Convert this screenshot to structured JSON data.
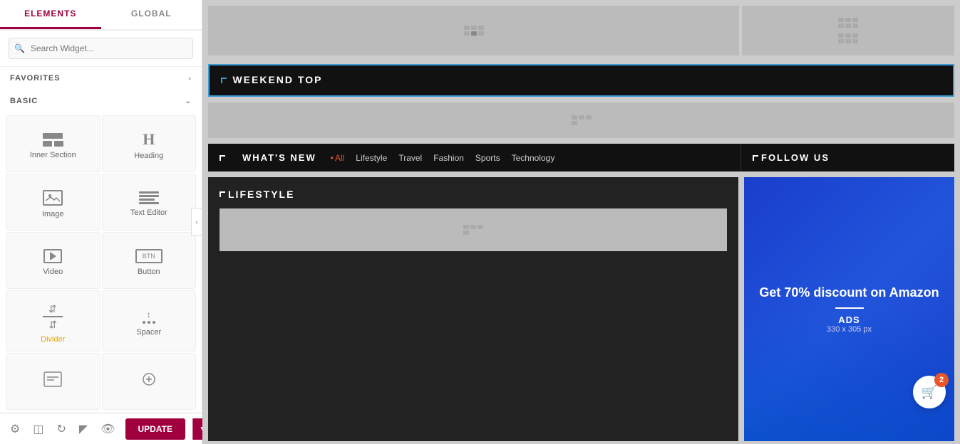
{
  "leftPanel": {
    "tabs": [
      {
        "id": "elements",
        "label": "ELEMENTS",
        "active": true
      },
      {
        "id": "global",
        "label": "GLOBAL",
        "active": false
      }
    ],
    "searchPlaceholder": "Search Widget...",
    "sections": {
      "favorites": {
        "label": "FAVORITES"
      },
      "basic": {
        "label": "BASIC",
        "widgets": [
          {
            "id": "inner-section",
            "label": "Inner Section"
          },
          {
            "id": "heading",
            "label": "Heading"
          },
          {
            "id": "image",
            "label": "Image"
          },
          {
            "id": "text-editor",
            "label": "Text Editor"
          },
          {
            "id": "video",
            "label": "Video"
          },
          {
            "id": "button",
            "label": "Button"
          },
          {
            "id": "divider",
            "label": "Divider"
          },
          {
            "id": "spacer",
            "label": "Spacer"
          }
        ]
      }
    },
    "toolbar": {
      "updateLabel": "UPDATE"
    }
  },
  "canvas": {
    "weekendSection": {
      "label": "WEEKEND TOP"
    },
    "whatsNew": {
      "title": "WHAT'S NEW",
      "navItems": [
        {
          "label": "All",
          "active": true
        },
        {
          "label": "Lifestyle"
        },
        {
          "label": "Travel"
        },
        {
          "label": "Fashion"
        },
        {
          "label": "Sports"
        },
        {
          "label": "Technology"
        }
      ]
    },
    "followUs": {
      "title": "FOLLOW US"
    },
    "lifestyle": {
      "title": "LIFESTYLE"
    },
    "ad": {
      "title": "Get 70% discount on Amazon",
      "subtitle": "ADS",
      "size": "330 x 305 px"
    },
    "cartBadge": "2"
  }
}
